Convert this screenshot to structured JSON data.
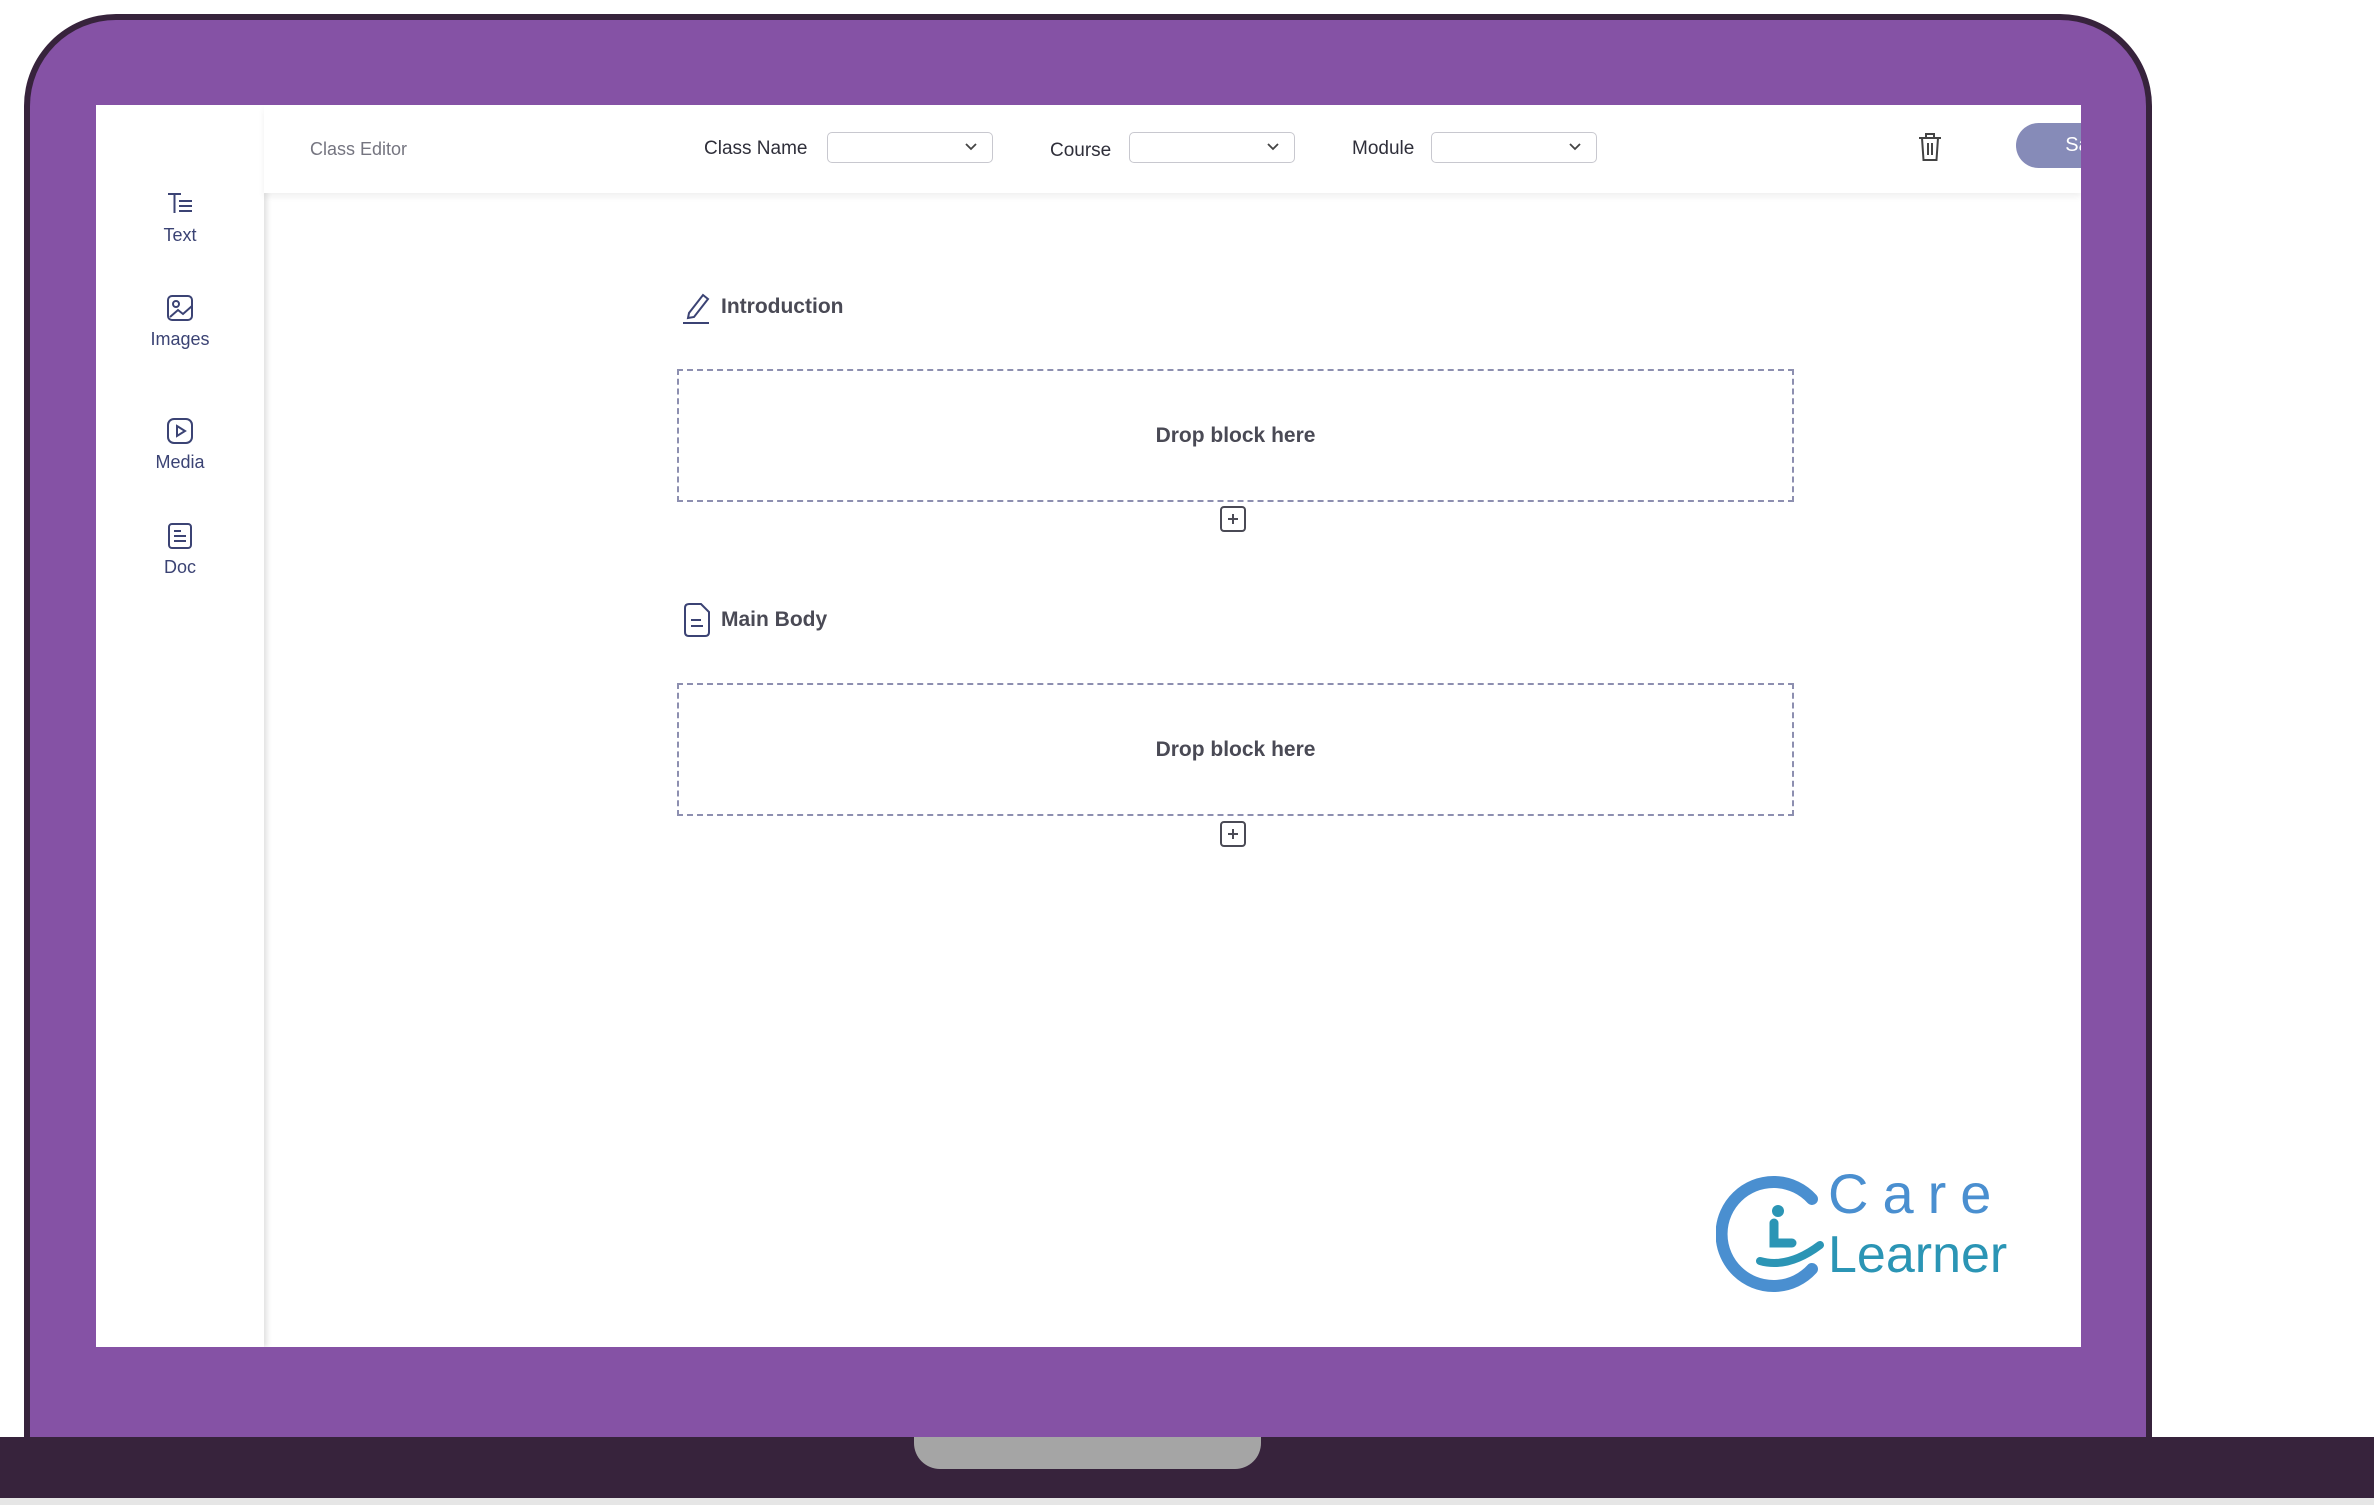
{
  "toolbar": {
    "crumb": "Class Editor",
    "class_name_label": "Class Name",
    "class_name_value": "",
    "course_label": "Course",
    "course_value": "",
    "module_label": "Module",
    "module_value": "",
    "delete_icon": "trash-icon",
    "save_label": "Save"
  },
  "sidebar": {
    "items": [
      {
        "label": "Text",
        "icon": "text-icon"
      },
      {
        "label": "Images",
        "icon": "image-icon"
      },
      {
        "label": "Media",
        "icon": "play-icon"
      },
      {
        "label": "Doc",
        "icon": "document-icon"
      }
    ]
  },
  "sections": [
    {
      "title": "Introduction",
      "icon": "pencil-icon",
      "dropzone_text": "Drop block here"
    },
    {
      "title": "Main Body",
      "icon": "file-icon",
      "dropzone_text": "Drop block here"
    }
  ],
  "logo": {
    "line1": "Care",
    "line2": "Learner"
  },
  "colors": {
    "frame": "#8552a5",
    "bezel": "#37233c",
    "accent": "#868bb8",
    "icon": "#3b4374",
    "logo_blue": "#4a8fd0",
    "logo_teal": "#2b95b5"
  }
}
